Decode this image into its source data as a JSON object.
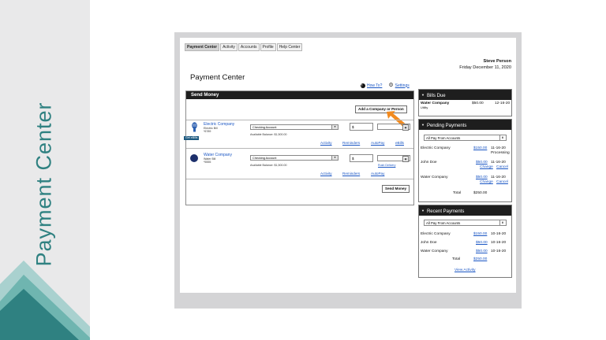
{
  "slide": {
    "title": "Payment Center"
  },
  "nav": {
    "tabs": [
      "Payment Center",
      "Activity",
      "Accounts",
      "Profile",
      "Help Center"
    ]
  },
  "user": {
    "name": "Steve Person",
    "date": "Friday December 11, 2020"
  },
  "page": {
    "title": "Payment Center"
  },
  "tools": {
    "howto": "How To?",
    "settings": "Settings"
  },
  "send_money": {
    "header": "Send Money",
    "add_payee": "Add a Company or Person",
    "send_button": "Send Money",
    "payees": [
      {
        "name": "Electric Company",
        "type": "Electric Bill",
        "account": "*6789",
        "tag": "Get eBills",
        "from_account": "Checking Account",
        "available": "Available Balance: $1,500.00",
        "amount_prefix": "$",
        "links": [
          "Activity",
          "Reminders",
          "AutoPay",
          "eBills"
        ]
      },
      {
        "name": "Water Company",
        "type": "Water Bill",
        "account": "*5555",
        "from_account": "Checking Account",
        "available": "Available Balance: $1,500.00",
        "amount_prefix": "$",
        "rush": "Rush Delivery",
        "links": [
          "Activity",
          "Reminders",
          "AutoPay"
        ]
      }
    ]
  },
  "bills_due": {
    "header": "Bills Due",
    "items": [
      {
        "name": "Water Company",
        "sub": "Utility",
        "amount": "$50.00",
        "date": "12-16-20"
      }
    ]
  },
  "pending": {
    "header": "Pending Payments",
    "filter": "All Pay From Accounts",
    "items": [
      {
        "name": "Electric Company",
        "amount": "$150.00",
        "date": "11-16-20",
        "status": "Processing"
      },
      {
        "name": "John Doe",
        "amount": "$50.00",
        "date": "11-16-20",
        "change": "Change",
        "cancel": "Cancel"
      },
      {
        "name": "Water Company",
        "amount": "$50.00",
        "date": "11-16-20",
        "change": "Change",
        "cancel": "Cancel"
      }
    ],
    "total_label": "Total",
    "total": "$250.00"
  },
  "recent": {
    "header": "Recent Payments",
    "filter": "All Pay From Accounts",
    "items": [
      {
        "name": "Electric Company",
        "amount": "$150.00",
        "date": "10-16-20"
      },
      {
        "name": "John Doe",
        "amount": "$50.00",
        "date": "10-16-20"
      },
      {
        "name": "Water Company",
        "amount": "$50.00",
        "date": "10-16-20"
      }
    ],
    "total_label": "Total",
    "total": "$250.00",
    "view_activity": "View Activity"
  },
  "colors": {
    "accent_teal": "#2f8181",
    "panel_header": "#1e1e1e",
    "link": "#1a56c4",
    "pointer": "#f28a1e"
  }
}
